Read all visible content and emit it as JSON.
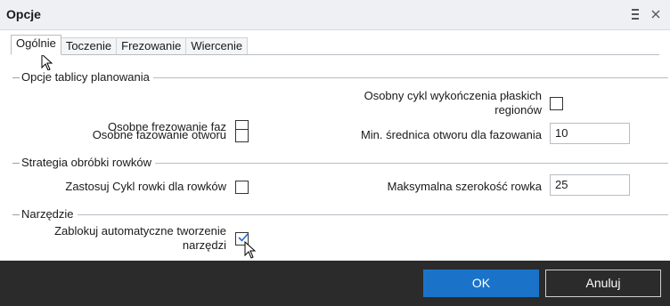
{
  "window": {
    "title": "Opcje"
  },
  "tabs": [
    {
      "label": "Ogólnie",
      "active": true
    },
    {
      "label": "Toczenie",
      "active": false
    },
    {
      "label": "Frezowanie",
      "active": false
    },
    {
      "label": "Wiercenie",
      "active": false
    }
  ],
  "sections": {
    "planning": {
      "label": "Opcje tablicy planowania",
      "separate_phase_milling": {
        "label": "Osobne frezowanie faz",
        "checked": false
      },
      "separate_finish_cycle": {
        "label_line1": "Osobny cykl wykończenia płaskich",
        "label_line2": "regionów",
        "checked": false
      },
      "separate_hole_chamfer": {
        "label": "Osobne fazowanie otworu",
        "checked": false
      },
      "min_hole_diameter": {
        "label": "Min. średnica otworu dla fazowania",
        "value": "10"
      }
    },
    "grooves": {
      "label": "Strategia obróbki rowków",
      "apply_groove_cycle": {
        "label": "Zastosuj Cykl rowki dla rowków",
        "checked": false
      },
      "max_groove_width": {
        "label": "Maksymalna szerokość rowka",
        "value": "25"
      }
    },
    "tools": {
      "label": "Narzędzie",
      "block_auto_tool": {
        "label_line1": "Zablokuj automatyczne tworzenie",
        "label_line2": "narzędzi",
        "checked": true
      }
    }
  },
  "footer": {
    "ok_label": "OK",
    "cancel_label": "Anuluj"
  },
  "colors": {
    "accent": "#1a73c9",
    "footer_bg": "#2b2b2b",
    "titlebar_bg": "#eef0f3"
  },
  "icons": {
    "menu": "menu-lines-icon",
    "close": "close-icon"
  }
}
